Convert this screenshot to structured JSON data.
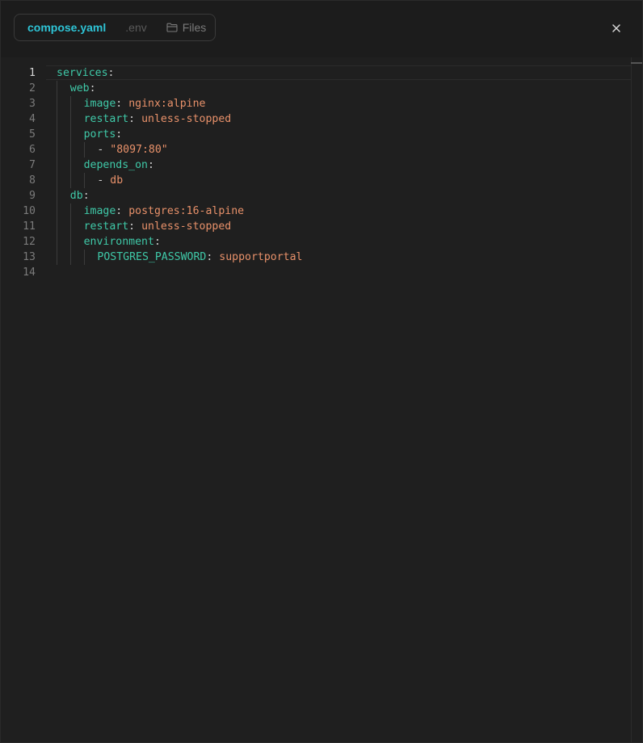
{
  "tabs": {
    "compose": "compose.yaml",
    "env": ".env",
    "files": "Files"
  },
  "icons": {
    "files": "folder-icon",
    "close": "close-icon"
  },
  "colors": {
    "accent": "#2ec4d6",
    "key": "#3fc9a8",
    "value": "#e8916a"
  },
  "editor": {
    "lines": [
      {
        "n": "1",
        "key": "services",
        "sep": ":",
        "val": ""
      },
      {
        "n": "2",
        "key": "web",
        "sep": ":",
        "val": ""
      },
      {
        "n": "3",
        "key": "image",
        "sep": ": ",
        "val": "nginx:alpine"
      },
      {
        "n": "4",
        "key": "restart",
        "sep": ": ",
        "val": "unless-stopped"
      },
      {
        "n": "5",
        "key": "ports",
        "sep": ":",
        "val": ""
      },
      {
        "n": "6",
        "key": "",
        "sep": "- ",
        "val": "\"8097:80\""
      },
      {
        "n": "7",
        "key": "depends_on",
        "sep": ":",
        "val": ""
      },
      {
        "n": "8",
        "key": "",
        "sep": "- ",
        "val": "db"
      },
      {
        "n": "9",
        "key": "db",
        "sep": ":",
        "val": ""
      },
      {
        "n": "10",
        "key": "image",
        "sep": ": ",
        "val": "postgres:16-alpine"
      },
      {
        "n": "11",
        "key": "restart",
        "sep": ": ",
        "val": "unless-stopped"
      },
      {
        "n": "12",
        "key": "environment",
        "sep": ":",
        "val": ""
      },
      {
        "n": "13",
        "key": "POSTGRES_PASSWORD",
        "sep": ": ",
        "val": "supportportal"
      },
      {
        "n": "14",
        "key": "",
        "sep": "",
        "val": ""
      }
    ]
  }
}
